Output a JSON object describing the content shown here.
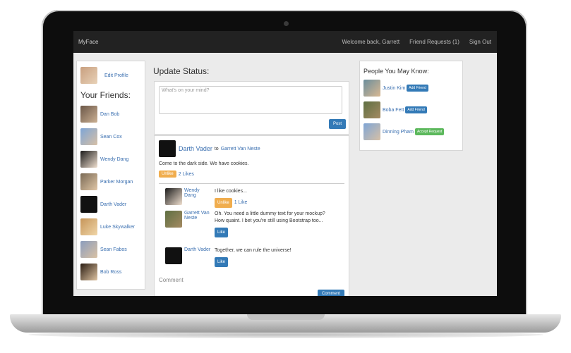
{
  "navbar": {
    "brand": "MyFace",
    "welcome": "Welcome back, Garrett",
    "friend_requests": "Friend Requests (1)",
    "sign_out": "Sign Out"
  },
  "sidebar": {
    "edit_profile": "Edit Profile",
    "friends_title": "Your Friends:",
    "friends": [
      {
        "name": "Dan Bob"
      },
      {
        "name": "Sean Cox"
      },
      {
        "name": "Wendy Dang"
      },
      {
        "name": "Parker Morgan"
      },
      {
        "name": "Darth Vader"
      },
      {
        "name": "Luke Skywalker"
      },
      {
        "name": "Sean Fabos"
      },
      {
        "name": "Bob Ross"
      }
    ]
  },
  "status": {
    "title": "Update Status:",
    "placeholder": "What's on your mind?",
    "post_label": "Post"
  },
  "feed": {
    "author": "Darth Vader",
    "to_text": "to",
    "recipient": "Garrett Van Neste",
    "text": "Come to the dark side. We have cookies.",
    "unlike_label": "Unlike",
    "likes_text": "2 Likes",
    "comments": [
      {
        "name": "Wendy Dang",
        "text": "I like cookies...",
        "btn": "Unlike",
        "likes": "1 Like"
      },
      {
        "name": "Garrett Van Neste",
        "text": "Oh. You need a little dummy text for your mockup? How quaint. I bet you're still using Bootstrap too...",
        "btn": "Like",
        "likes": ""
      },
      {
        "name": "Darth Vader",
        "text": "Together, we can rule the universe!",
        "btn": "Like",
        "likes": ""
      }
    ],
    "comment_label": "Comment",
    "comment_button": "Comment"
  },
  "suggestions": {
    "title": "People You May Know:",
    "people": [
      {
        "name": "Justin Kim",
        "action": "Add Friend",
        "color": "#337ab7"
      },
      {
        "name": "Boba Fett",
        "action": "Add Friend",
        "color": "#337ab7"
      },
      {
        "name": "Dinning Pham",
        "action": "Accept Request",
        "color": "#5cb85c"
      }
    ]
  }
}
